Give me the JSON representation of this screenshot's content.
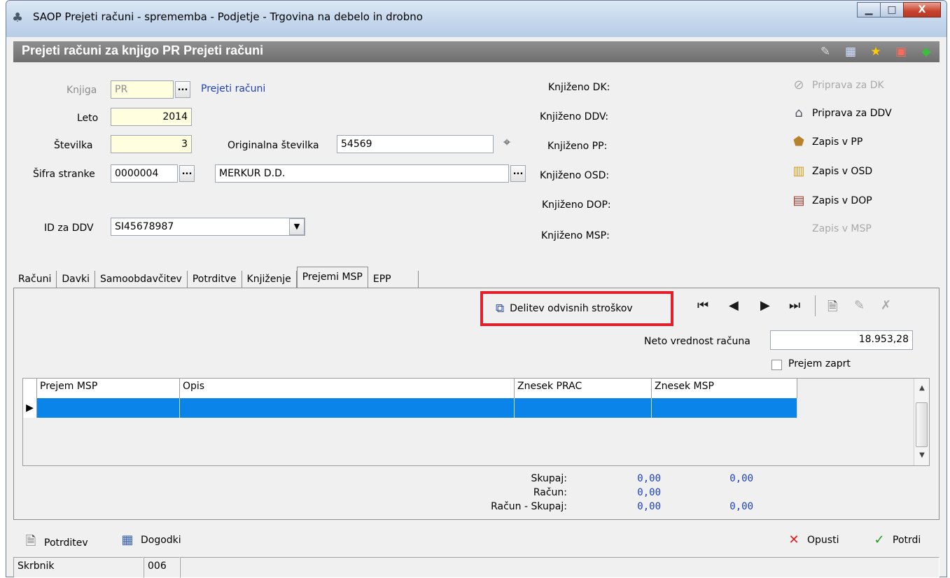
{
  "window": {
    "title": "SAOP Prejeti računi - sprememba - Podjetje - Trgovina na debelo in drobno",
    "minimize": "▁",
    "maximize": "□",
    "close": "X"
  },
  "header": {
    "title": "Prejeti računi za knjigo PR Prejeti računi",
    "icons": [
      "edit-icon",
      "calendar-icon",
      "star-icon",
      "pdf-icon",
      "book-icon"
    ]
  },
  "form": {
    "knjiga": {
      "label": "Knjiga",
      "value": "PR",
      "link": "Prejeti računi"
    },
    "leto": {
      "label": "Leto",
      "value": "2014"
    },
    "stevilka": {
      "label": "Številka",
      "value": "3"
    },
    "originalna": {
      "label": "Originalna številka",
      "value": "54569"
    },
    "sifra": {
      "label": "Šifra stranke",
      "value": "0000004",
      "name": "MERKUR D.D."
    },
    "id_ddv": {
      "label": "ID za DDV",
      "value": "SI45678987"
    },
    "ellipsis": "...",
    "knjizeno": [
      "Knjiženo DK:",
      "Knjiženo DDV:",
      "Knjiženo PP:",
      "Knjiženo OSD:",
      "Knjiženo DOP:",
      "Knjiženo MSP:"
    ]
  },
  "actions": [
    {
      "label": "Priprava za DK",
      "icon": "chain-icon",
      "enabled": false
    },
    {
      "label": "Priprava za DDV",
      "icon": "house-icon",
      "enabled": true
    },
    {
      "label": "Zapis v PP",
      "icon": "map-icon",
      "enabled": true
    },
    {
      "label": "Zapis v OSD",
      "icon": "shelves-icon",
      "enabled": true
    },
    {
      "label": "Zapis v DOP",
      "icon": "boxes-icon",
      "enabled": true
    },
    {
      "label": "Zapis v MSP",
      "icon": "",
      "enabled": false
    }
  ],
  "tabs": [
    "Računi",
    "Davki",
    "Samoobdavčitev",
    "Potrditve",
    "Knjiženje",
    "Prejemi MSP",
    "EPP"
  ],
  "active_tab": "Prejemi MSP",
  "panel": {
    "delitev_label": "Delitev odvisnih stroškov",
    "neto_label": "Neto vrednost računa",
    "neto_value": "18.953,28",
    "prejem_zaprt": "Prejem zaprt"
  },
  "grid": {
    "columns": [
      "Prejem MSP",
      "Opis",
      "Znesek PRAC",
      "Znesek MSP"
    ],
    "row_indicator": "▶"
  },
  "totals": {
    "labels": [
      "Skupaj:",
      "Račun:",
      "Račun - Skupaj:"
    ],
    "prac": [
      "0,00",
      "0,00",
      "0,00"
    ],
    "msp": [
      "0,00",
      "",
      "0,00"
    ]
  },
  "bottom": {
    "potrditev": "Potrditev",
    "dogodki": "Dogodki",
    "opusti": "Opusti",
    "potrdi": "Potrdi"
  },
  "status": {
    "label": "Skrbnik",
    "value": "006"
  }
}
